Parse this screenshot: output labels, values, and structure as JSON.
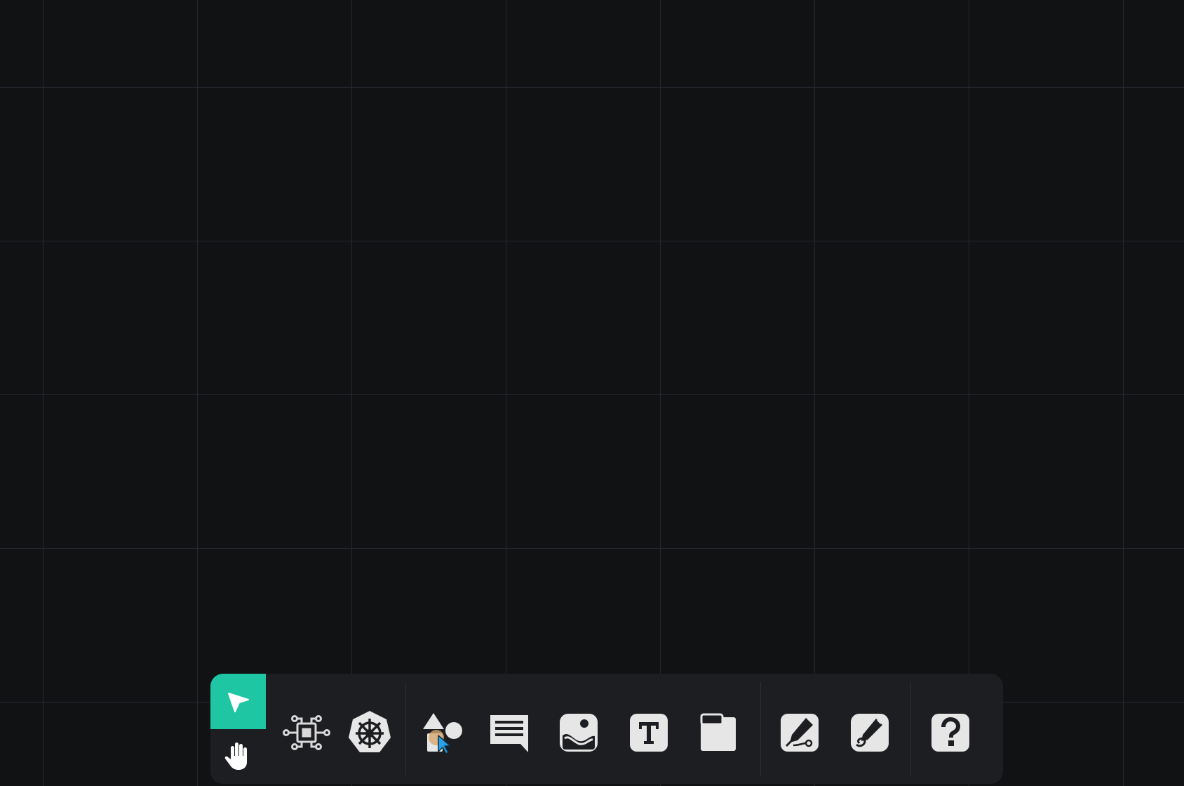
{
  "canvas": {
    "background": "#111214",
    "grid_color": "#262830"
  },
  "toolbar": {
    "background": "#1d1e21",
    "accent": "#1fc6a4",
    "icon_color": "#e6e6e6",
    "modes": [
      {
        "id": "select",
        "icon": "cursor-arrow-icon",
        "active": true
      },
      {
        "id": "pan",
        "icon": "hand-icon",
        "active": false
      }
    ],
    "tools": [
      {
        "id": "component",
        "icon": "chip-circuit-icon"
      },
      {
        "id": "kubernetes",
        "icon": "helm-wheel-icon"
      },
      {
        "id": "shapes",
        "icon": "shapes-icon"
      },
      {
        "id": "comment",
        "icon": "comment-icon"
      },
      {
        "id": "image",
        "icon": "image-icon"
      },
      {
        "id": "text",
        "icon": "text-icon"
      },
      {
        "id": "section",
        "icon": "frame-icon"
      },
      {
        "id": "pen",
        "icon": "pen-icon"
      },
      {
        "id": "pencil",
        "icon": "pencil-icon"
      },
      {
        "id": "help",
        "icon": "help-icon"
      }
    ]
  }
}
